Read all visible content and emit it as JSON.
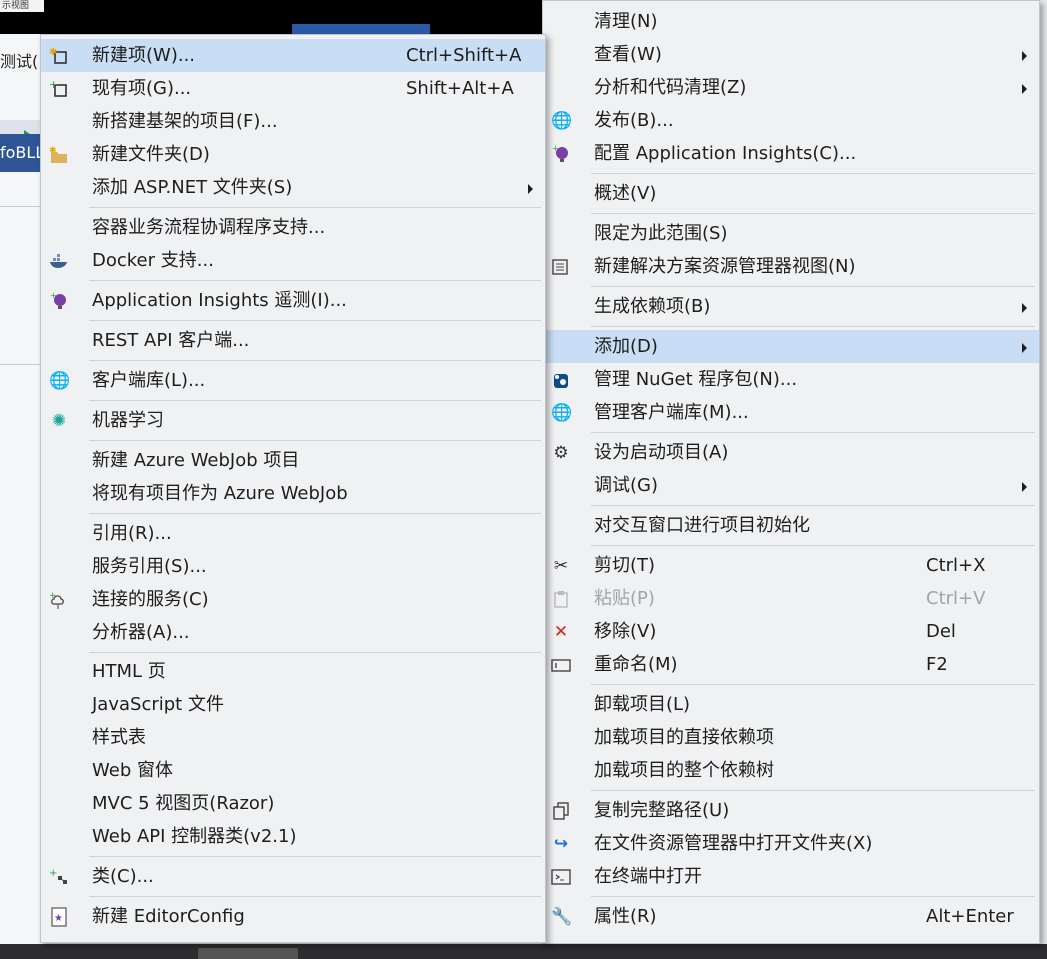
{
  "background": {
    "top_chip": "示视图",
    "left_label": "测试(",
    "left_tab": "foBLL"
  },
  "submenu": {
    "items": [
      {
        "label": "新建项(W)...",
        "shortcut": "Ctrl+Shift+A",
        "icon": "new-item-icon",
        "highlighted": true
      },
      {
        "label": "现有项(G)...",
        "shortcut": "Shift+Alt+A",
        "icon": "existing-item-icon"
      },
      {
        "label": "新搭建基架的项目(F)..."
      },
      {
        "label": "新建文件夹(D)",
        "icon": "new-folder-icon"
      },
      {
        "label": "添加 ASP.NET 文件夹(S)",
        "submenu": true
      },
      {
        "label": "容器业务流程协调程序支持..."
      },
      {
        "label": "Docker 支持...",
        "icon": "docker-icon"
      },
      {
        "label": "Application Insights 遥测(I)...",
        "icon": "app-insights-icon"
      },
      {
        "label": "REST API 客户端..."
      },
      {
        "label": "客户端库(L)...",
        "icon": "client-library-icon"
      },
      {
        "label": "机器学习",
        "icon": "machine-learning-icon"
      },
      {
        "label": "新建 Azure WebJob 项目"
      },
      {
        "label": "将现有项目作为 Azure WebJob"
      },
      {
        "label": "引用(R)..."
      },
      {
        "label": "服务引用(S)..."
      },
      {
        "label": "连接的服务(C)",
        "icon": "connected-service-icon"
      },
      {
        "label": "分析器(A)..."
      },
      {
        "label": "HTML 页"
      },
      {
        "label": "JavaScript 文件"
      },
      {
        "label": "样式表"
      },
      {
        "label": "Web 窗体"
      },
      {
        "label": "MVC 5 视图页(Razor)"
      },
      {
        "label": "Web API 控制器类(v2.1)"
      },
      {
        "label": "类(C)...",
        "icon": "class-icon"
      },
      {
        "label": "新建 EditorConfig",
        "icon": "editorconfig-icon"
      }
    ]
  },
  "context": {
    "items": [
      {
        "label": "清理(N)"
      },
      {
        "label": "查看(W)",
        "submenu": true
      },
      {
        "label": "分析和代码清理(Z)",
        "submenu": true
      },
      {
        "label": "发布(B)...",
        "icon": "publish-icon"
      },
      {
        "label": "配置 Application Insights(C)...",
        "icon": "app-insights-icon"
      },
      {
        "label": "概述(V)"
      },
      {
        "label": "限定为此范围(S)"
      },
      {
        "label": "新建解决方案资源管理器视图(N)",
        "icon": "new-view-icon"
      },
      {
        "label": "生成依赖项(B)",
        "submenu": true
      },
      {
        "label": "添加(D)",
        "submenu": true,
        "highlighted": true
      },
      {
        "label": "管理 NuGet 程序包(N)...",
        "icon": "nuget-icon"
      },
      {
        "label": "管理客户端库(M)...",
        "icon": "client-library-icon"
      },
      {
        "label": "设为启动项目(A)",
        "icon": "gear-icon"
      },
      {
        "label": "调试(G)",
        "submenu": true
      },
      {
        "label": "对交互窗口进行项目初始化"
      },
      {
        "label": "剪切(T)",
        "shortcut": "Ctrl+X",
        "icon": "scissors-icon"
      },
      {
        "label": "粘贴(P)",
        "shortcut": "Ctrl+V",
        "icon": "paste-icon",
        "disabled": true
      },
      {
        "label": "移除(V)",
        "shortcut": "Del",
        "icon": "close-icon"
      },
      {
        "label": "重命名(M)",
        "shortcut": "F2",
        "icon": "rename-icon"
      },
      {
        "label": "卸载项目(L)"
      },
      {
        "label": "加载项目的直接依赖项"
      },
      {
        "label": "加载项目的整个依赖树"
      },
      {
        "label": "复制完整路径(U)",
        "icon": "copy-icon"
      },
      {
        "label": "在文件资源管理器中打开文件夹(X)",
        "icon": "redo-arrow-icon"
      },
      {
        "label": "在终端中打开",
        "icon": "terminal-icon"
      },
      {
        "label": "属性(R)",
        "shortcut": "Alt+Enter",
        "icon": "wrench-icon"
      }
    ]
  },
  "colors": {
    "menu_bg": "#f0f1f3",
    "highlight": "#c9ddf4",
    "separator": "#cfd2d8",
    "disabled_text": "#a2a4a8"
  }
}
